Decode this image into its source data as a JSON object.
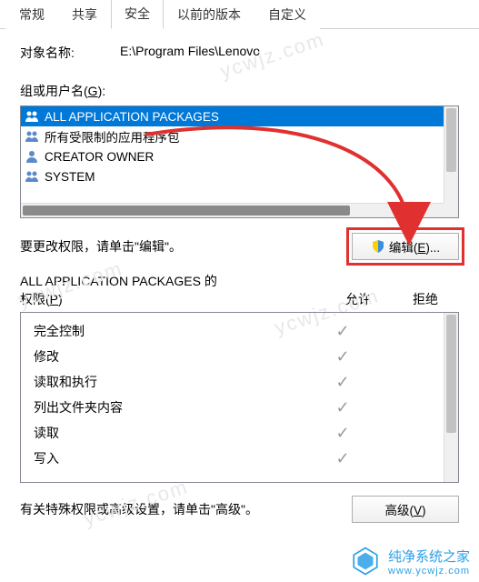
{
  "tabs": {
    "items": [
      {
        "label": "常规"
      },
      {
        "label": "共享"
      },
      {
        "label": "安全",
        "active": true
      },
      {
        "label": "以前的版本"
      },
      {
        "label": "自定义"
      }
    ]
  },
  "object": {
    "label": "对象名称:",
    "value": "E:\\Program Files\\Lenovo"
  },
  "groups": {
    "label_pre": "组或用户名(",
    "label_u": "G",
    "label_post": "):",
    "items": [
      {
        "name": "ALL APPLICATION PACKAGES",
        "selected": true,
        "icon": "group"
      },
      {
        "name": "所有受限制的应用程序包",
        "icon": "group"
      },
      {
        "name": "CREATOR OWNER",
        "icon": "user"
      },
      {
        "name": "SYSTEM",
        "icon": "users"
      }
    ]
  },
  "edit": {
    "text": "要更改权限，请单击\"编辑\"。",
    "button_pre": "编辑(",
    "button_u": "E",
    "button_post": ")..."
  },
  "permissions": {
    "title_line1": "ALL APPLICATION PACKAGES 的",
    "title_pre": "权限(",
    "title_u": "P",
    "title_post": ")",
    "col_allow": "允许",
    "col_deny": "拒绝",
    "rows": [
      {
        "name": "完全控制",
        "allow": true,
        "deny": false
      },
      {
        "name": "修改",
        "allow": true,
        "deny": false
      },
      {
        "name": "读取和执行",
        "allow": true,
        "deny": false
      },
      {
        "name": "列出文件夹内容",
        "allow": true,
        "deny": false
      },
      {
        "name": "读取",
        "allow": true,
        "deny": false
      },
      {
        "name": "写入",
        "allow": true,
        "deny": false
      }
    ]
  },
  "advanced": {
    "text": "有关特殊权限或高级设置，请单击\"高级\"。",
    "button_pre": "高级(",
    "button_u": "V",
    "button_post": ")"
  },
  "branding": {
    "name": "纯净系统之家",
    "url": "www.ycwjz.com",
    "watermark": "ycwjz.com"
  },
  "colors": {
    "select_bg": "#0078d7",
    "highlight": "#e03030",
    "check": "#9a9a9a"
  }
}
